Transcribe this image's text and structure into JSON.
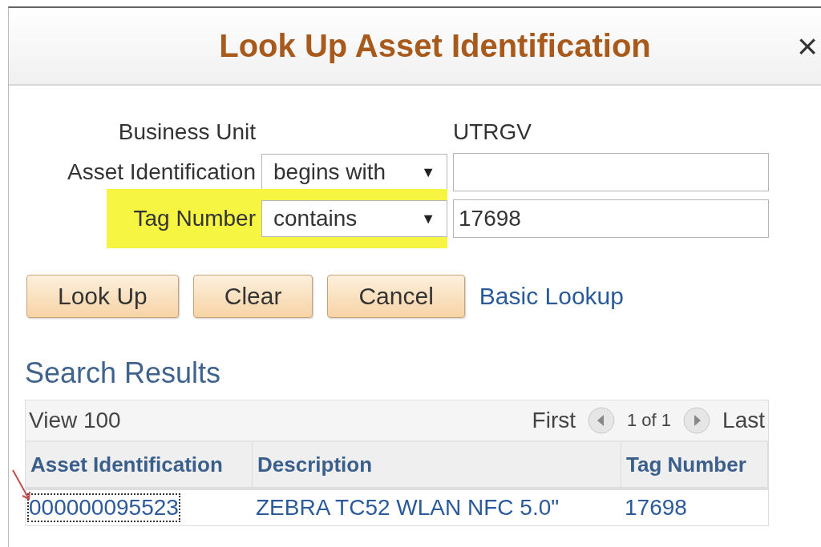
{
  "dialog": {
    "title": "Look Up Asset Identification",
    "close": "×"
  },
  "criteria": [
    {
      "kind": "display",
      "label": "Business Unit",
      "value": "UTRGV"
    },
    {
      "kind": "search",
      "label": "Asset Identification",
      "operator": "begins with",
      "caret": "▼"
    },
    {
      "kind": "search",
      "label": "Tag Number",
      "operator": "contains",
      "caret": "▼",
      "value": "17698",
      "highlighted": true
    }
  ],
  "buttons": [
    "Look Up",
    "Clear",
    "Cancel"
  ],
  "link": "Basic Lookup",
  "results": {
    "title": "Search Results",
    "view": "View 100",
    "first": "First",
    "count": "1 of 1",
    "last": "Last",
    "columns": [
      "Asset Identification",
      "Description",
      "Tag Number"
    ],
    "rows": [
      {
        "cells": [
          "000000095523",
          "ZEBRA TC52 WLAN NFC 5.0\"",
          "17698"
        ],
        "focused": true
      }
    ]
  }
}
